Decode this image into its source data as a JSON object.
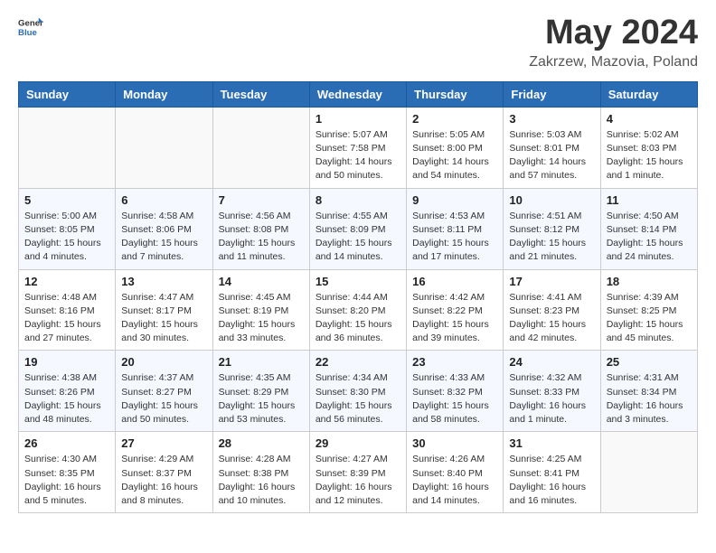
{
  "header": {
    "logo_general": "General",
    "logo_blue": "Blue",
    "month_title": "May 2024",
    "location": "Zakrzew, Mazovia, Poland"
  },
  "days_of_week": [
    "Sunday",
    "Monday",
    "Tuesday",
    "Wednesday",
    "Thursday",
    "Friday",
    "Saturday"
  ],
  "weeks": [
    [
      {
        "day": "",
        "info": ""
      },
      {
        "day": "",
        "info": ""
      },
      {
        "day": "",
        "info": ""
      },
      {
        "day": "1",
        "info": "Sunrise: 5:07 AM\nSunset: 7:58 PM\nDaylight: 14 hours\nand 50 minutes."
      },
      {
        "day": "2",
        "info": "Sunrise: 5:05 AM\nSunset: 8:00 PM\nDaylight: 14 hours\nand 54 minutes."
      },
      {
        "day": "3",
        "info": "Sunrise: 5:03 AM\nSunset: 8:01 PM\nDaylight: 14 hours\nand 57 minutes."
      },
      {
        "day": "4",
        "info": "Sunrise: 5:02 AM\nSunset: 8:03 PM\nDaylight: 15 hours\nand 1 minute."
      }
    ],
    [
      {
        "day": "5",
        "info": "Sunrise: 5:00 AM\nSunset: 8:05 PM\nDaylight: 15 hours\nand 4 minutes."
      },
      {
        "day": "6",
        "info": "Sunrise: 4:58 AM\nSunset: 8:06 PM\nDaylight: 15 hours\nand 7 minutes."
      },
      {
        "day": "7",
        "info": "Sunrise: 4:56 AM\nSunset: 8:08 PM\nDaylight: 15 hours\nand 11 minutes."
      },
      {
        "day": "8",
        "info": "Sunrise: 4:55 AM\nSunset: 8:09 PM\nDaylight: 15 hours\nand 14 minutes."
      },
      {
        "day": "9",
        "info": "Sunrise: 4:53 AM\nSunset: 8:11 PM\nDaylight: 15 hours\nand 17 minutes."
      },
      {
        "day": "10",
        "info": "Sunrise: 4:51 AM\nSunset: 8:12 PM\nDaylight: 15 hours\nand 21 minutes."
      },
      {
        "day": "11",
        "info": "Sunrise: 4:50 AM\nSunset: 8:14 PM\nDaylight: 15 hours\nand 24 minutes."
      }
    ],
    [
      {
        "day": "12",
        "info": "Sunrise: 4:48 AM\nSunset: 8:16 PM\nDaylight: 15 hours\nand 27 minutes."
      },
      {
        "day": "13",
        "info": "Sunrise: 4:47 AM\nSunset: 8:17 PM\nDaylight: 15 hours\nand 30 minutes."
      },
      {
        "day": "14",
        "info": "Sunrise: 4:45 AM\nSunset: 8:19 PM\nDaylight: 15 hours\nand 33 minutes."
      },
      {
        "day": "15",
        "info": "Sunrise: 4:44 AM\nSunset: 8:20 PM\nDaylight: 15 hours\nand 36 minutes."
      },
      {
        "day": "16",
        "info": "Sunrise: 4:42 AM\nSunset: 8:22 PM\nDaylight: 15 hours\nand 39 minutes."
      },
      {
        "day": "17",
        "info": "Sunrise: 4:41 AM\nSunset: 8:23 PM\nDaylight: 15 hours\nand 42 minutes."
      },
      {
        "day": "18",
        "info": "Sunrise: 4:39 AM\nSunset: 8:25 PM\nDaylight: 15 hours\nand 45 minutes."
      }
    ],
    [
      {
        "day": "19",
        "info": "Sunrise: 4:38 AM\nSunset: 8:26 PM\nDaylight: 15 hours\nand 48 minutes."
      },
      {
        "day": "20",
        "info": "Sunrise: 4:37 AM\nSunset: 8:27 PM\nDaylight: 15 hours\nand 50 minutes."
      },
      {
        "day": "21",
        "info": "Sunrise: 4:35 AM\nSunset: 8:29 PM\nDaylight: 15 hours\nand 53 minutes."
      },
      {
        "day": "22",
        "info": "Sunrise: 4:34 AM\nSunset: 8:30 PM\nDaylight: 15 hours\nand 56 minutes."
      },
      {
        "day": "23",
        "info": "Sunrise: 4:33 AM\nSunset: 8:32 PM\nDaylight: 15 hours\nand 58 minutes."
      },
      {
        "day": "24",
        "info": "Sunrise: 4:32 AM\nSunset: 8:33 PM\nDaylight: 16 hours\nand 1 minute."
      },
      {
        "day": "25",
        "info": "Sunrise: 4:31 AM\nSunset: 8:34 PM\nDaylight: 16 hours\nand 3 minutes."
      }
    ],
    [
      {
        "day": "26",
        "info": "Sunrise: 4:30 AM\nSunset: 8:35 PM\nDaylight: 16 hours\nand 5 minutes."
      },
      {
        "day": "27",
        "info": "Sunrise: 4:29 AM\nSunset: 8:37 PM\nDaylight: 16 hours\nand 8 minutes."
      },
      {
        "day": "28",
        "info": "Sunrise: 4:28 AM\nSunset: 8:38 PM\nDaylight: 16 hours\nand 10 minutes."
      },
      {
        "day": "29",
        "info": "Sunrise: 4:27 AM\nSunset: 8:39 PM\nDaylight: 16 hours\nand 12 minutes."
      },
      {
        "day": "30",
        "info": "Sunrise: 4:26 AM\nSunset: 8:40 PM\nDaylight: 16 hours\nand 14 minutes."
      },
      {
        "day": "31",
        "info": "Sunrise: 4:25 AM\nSunset: 8:41 PM\nDaylight: 16 hours\nand 16 minutes."
      },
      {
        "day": "",
        "info": ""
      }
    ]
  ]
}
